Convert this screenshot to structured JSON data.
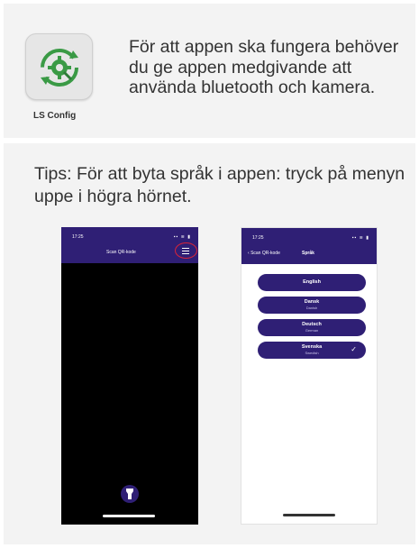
{
  "top_card": {
    "app_name": "LS Config",
    "app_icon": "ls-config-app-icon",
    "info_text": "För att appen ska fungera behöver du ge appen medgivande att använda bluetooth och kamera."
  },
  "bottom_card": {
    "tips_text": "Tips: För att byta språk i appen: tryck på menyn uppe i högra hörnet."
  },
  "phone_left": {
    "time": "17:25",
    "status": "▪▪ ≋ ▮",
    "title": "Scan QR-kode",
    "menu_icon": "hamburger-menu-icon",
    "bottom_button_icon": "flashlight-icon",
    "highlight_color": "#d6243a"
  },
  "phone_right": {
    "time": "17:25",
    "status": "▪▪ ≋ ▮",
    "back_label": "Scan QR-kode",
    "title": "Språk",
    "languages": [
      {
        "name": "English",
        "sub": ""
      },
      {
        "name": "Dansk",
        "sub": "Danish"
      },
      {
        "name": "Deutsch",
        "sub": "German"
      },
      {
        "name": "Svenska",
        "sub": "Swedish",
        "selected": true
      }
    ]
  },
  "colors": {
    "accent": "#2f1f75",
    "card_bg": "#f3f3f3",
    "icon_green": "#3a9a45"
  }
}
